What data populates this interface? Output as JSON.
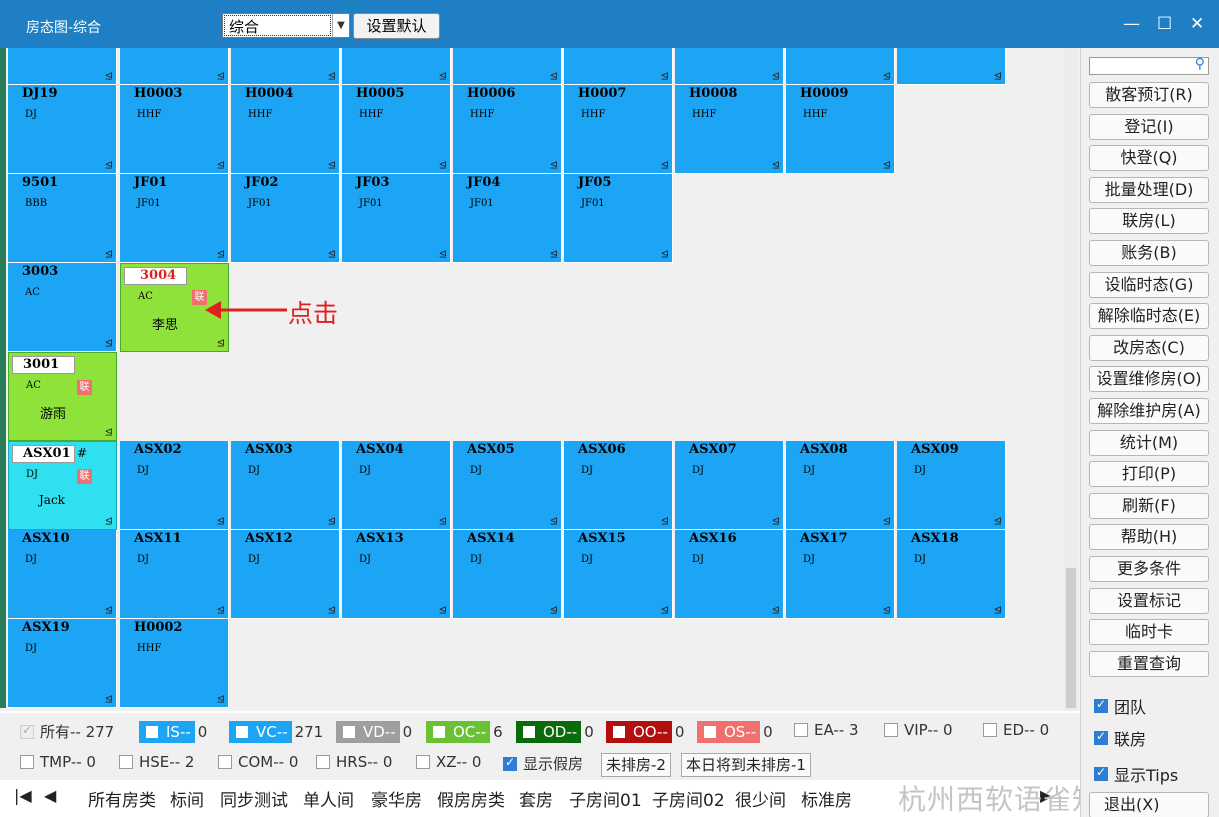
{
  "window": {
    "title": "房态图-综合",
    "minimize": "—",
    "maximize": "☐",
    "close": "✕"
  },
  "toolbar": {
    "view_select": "综合",
    "set_default": "设置默认"
  },
  "rooms": {
    "r2": [
      {
        "code": "DJ19",
        "type": "DJ"
      },
      {
        "code": "H0003",
        "type": "HHF"
      },
      {
        "code": "H0004",
        "type": "HHF"
      },
      {
        "code": "H0005",
        "type": "HHF"
      },
      {
        "code": "H0006",
        "type": "HHF"
      },
      {
        "code": "H0007",
        "type": "HHF"
      },
      {
        "code": "H0008",
        "type": "HHF"
      },
      {
        "code": "H0009",
        "type": "HHF"
      }
    ],
    "r3": [
      {
        "code": "9501",
        "type": "BBB"
      },
      {
        "code": "JF01",
        "type": "JF01"
      },
      {
        "code": "JF02",
        "type": "JF01"
      },
      {
        "code": "JF03",
        "type": "JF01"
      },
      {
        "code": "JF04",
        "type": "JF01"
      },
      {
        "code": "JF05",
        "type": "JF01"
      }
    ],
    "r4": [
      {
        "code": "3003",
        "type": "AC"
      },
      {
        "code": "3004",
        "type": "AC",
        "guest": "李思",
        "tag": "联"
      }
    ],
    "r5": [
      {
        "code": "3001",
        "type": "AC",
        "guest": "游雨",
        "tag": "联"
      }
    ],
    "r6": [
      {
        "code": "ASX01",
        "type": "DJ",
        "guest": "Jack",
        "tag": "联",
        "mini": "#"
      },
      {
        "code": "ASX02",
        "type": "DJ"
      },
      {
        "code": "ASX03",
        "type": "DJ"
      },
      {
        "code": "ASX04",
        "type": "DJ"
      },
      {
        "code": "ASX05",
        "type": "DJ"
      },
      {
        "code": "ASX06",
        "type": "DJ"
      },
      {
        "code": "ASX07",
        "type": "DJ"
      },
      {
        "code": "ASX08",
        "type": "DJ"
      },
      {
        "code": "ASX09",
        "type": "DJ"
      }
    ],
    "r7": [
      {
        "code": "ASX10",
        "type": "DJ"
      },
      {
        "code": "ASX11",
        "type": "DJ"
      },
      {
        "code": "ASX12",
        "type": "DJ"
      },
      {
        "code": "ASX13",
        "type": "DJ"
      },
      {
        "code": "ASX14",
        "type": "DJ"
      },
      {
        "code": "ASX15",
        "type": "DJ"
      },
      {
        "code": "ASX16",
        "type": "DJ"
      },
      {
        "code": "ASX17",
        "type": "DJ"
      },
      {
        "code": "ASX18",
        "type": "DJ"
      }
    ],
    "r8": [
      {
        "code": "ASX19",
        "type": "DJ"
      },
      {
        "code": "H0002",
        "type": "HHF"
      }
    ]
  },
  "annotation": "点击",
  "legend": {
    "all": "所有-- 277",
    "is": "IS--",
    "is_count": "0",
    "vc": "VC--",
    "vc_count": "271",
    "vd": "VD--",
    "vd_count": "0",
    "oc": "OC--",
    "oc_count": "6",
    "od": "OD--",
    "od_count": "0",
    "oo": "OO--",
    "oo_count": "0",
    "os": "OS--",
    "os_count": "0",
    "ea": "EA-- 3",
    "vip": "VIP-- 0",
    "ed": "ED-- 0",
    "tmp": "TMP-- 0",
    "hse": "HSE-- 2",
    "com": "COM-- 0",
    "hrs": "HRS-- 0",
    "xz": "XZ-- 0",
    "show_fake": "显示假房",
    "unassigned": "未排房-2",
    "arriving_unassigned": "本日将到未排房-1"
  },
  "colors": {
    "is": "#1ca5f5",
    "vc": "#1ca5f5",
    "vd": "#9e9e9e",
    "oc": "#69c232",
    "od": "#0a6b0a",
    "oo": "#b30f0f",
    "os": "#f07070"
  },
  "tabs": [
    "所有房类",
    "标间",
    "同步测试",
    "单人间",
    "豪华房",
    "假房房类",
    "套房",
    "子房间01",
    "子房间02",
    "很少间",
    "标准房"
  ],
  "watermark": "杭州西软语雀知识库",
  "actions": [
    "散客预订(R)",
    "登记(I)",
    "快登(Q)",
    "批量处理(D)",
    "联房(L)",
    "账务(B)",
    "设临时态(G)",
    "解除临时态(E)",
    "改房态(C)",
    "设置维修房(O)",
    "解除维护房(A)",
    "统计(M)",
    "打印(P)",
    "刷新(F)",
    "帮助(H)",
    "更多条件",
    "设置标记",
    "临时卡",
    "重置查询"
  ],
  "options": {
    "team": "团队",
    "linked": "联房",
    "tips": "显示Tips"
  },
  "exit": "退出(X)"
}
